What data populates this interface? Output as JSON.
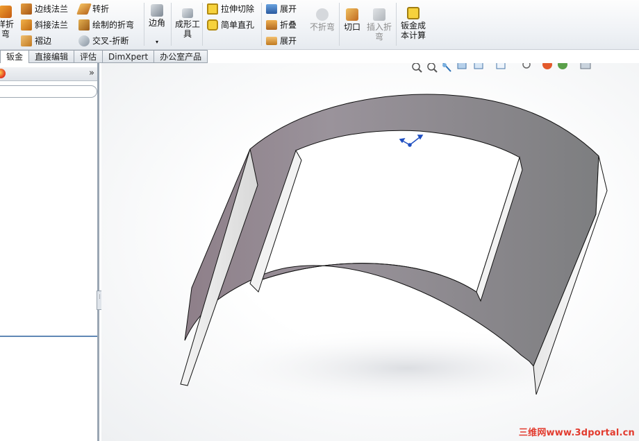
{
  "ribbon": {
    "left_partial_label": "样折\n弯",
    "col1": [
      "边线法兰",
      "斜接法兰",
      "褶边"
    ],
    "col2": [
      "转折",
      "绘制的折弯",
      "交叉-折断"
    ],
    "corner": "边角",
    "forming_tool": "成形工\n具",
    "col3": [
      "拉伸切除",
      "简单直孔"
    ],
    "col4": [
      "展开",
      "折叠",
      "展开"
    ],
    "no_bend": "不折弯",
    "rip": "切口",
    "insert_bends": "插入折\n弯",
    "cost": "钣金成\n本计算"
  },
  "tabs": [
    "钣金",
    "直接编辑",
    "评估",
    "DimXpert",
    "办公室产品"
  ],
  "left_panel": {
    "expand_glyph": "»",
    "handle_glyph": "⋮"
  },
  "viewport": {
    "view_tools": [
      "zoom-to-fit-icon",
      "zoom-to-area-icon",
      "previous-view-icon",
      "section-view-icon",
      "view-orientation-icon",
      "display-style-icon",
      "hide-show-items-icon",
      "edit-appearance-icon",
      "apply-scene-icon",
      "view-settings-icon"
    ]
  },
  "watermark": "三维网www.3dportal.cn",
  "colors": {
    "accent_blue": "#1f4fc1",
    "watermark_red": "#e23b2e",
    "panel_border": "#9aa6b3"
  }
}
